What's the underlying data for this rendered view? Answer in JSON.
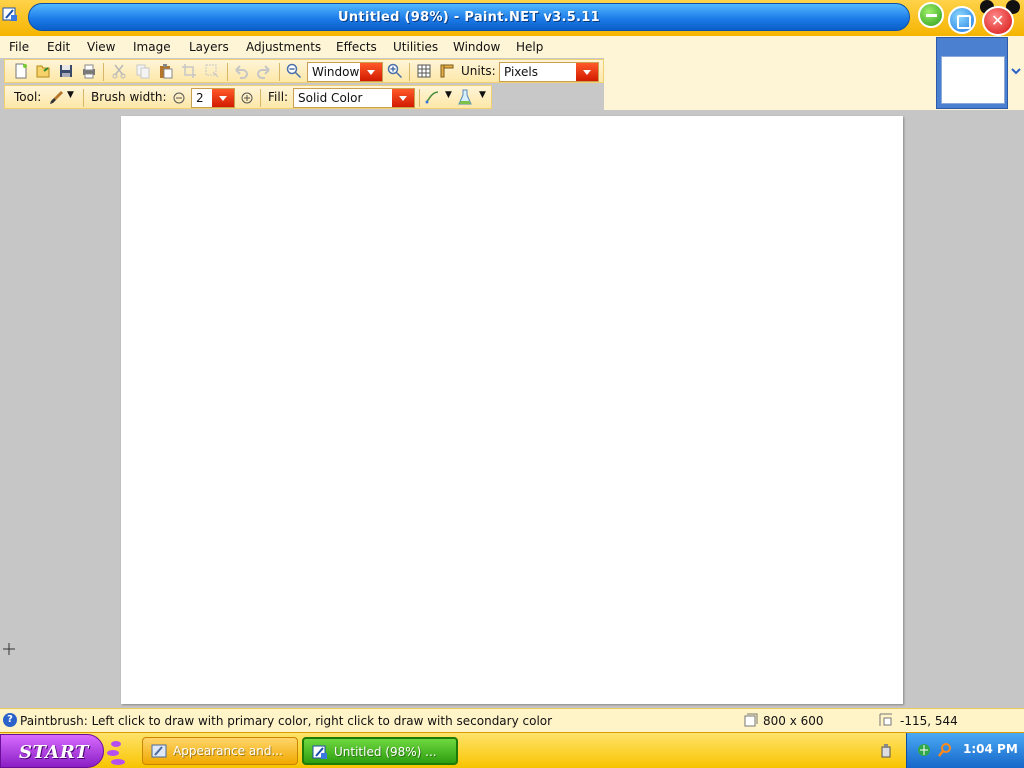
{
  "window": {
    "title": "Untitled (98%) - Paint.NET v3.5.11"
  },
  "menu": [
    "File",
    "Edit",
    "View",
    "Image",
    "Layers",
    "Adjustments",
    "Effects",
    "Utilities",
    "Window",
    "Help"
  ],
  "toolbar": {
    "zoom_value": "Window",
    "units_label": "Units:",
    "units_value": "Pixels",
    "tool_label": "Tool:",
    "brush_width_label": "Brush width:",
    "brush_width_value": "2",
    "fill_label": "Fill:",
    "fill_value": "Solid Color"
  },
  "status": {
    "message": "Paintbrush: Left click to draw with primary color, right click to draw with secondary color",
    "image_size": "800 x 600",
    "cursor_position": "-115, 544"
  },
  "taskbar": {
    "start_label": "START",
    "tasks": [
      {
        "label": "Appearance and...",
        "active": false
      },
      {
        "label": "Untitled (98%) ...",
        "active": true
      }
    ],
    "clock": "1:04 PM"
  },
  "colors": {
    "title_bar": "#1a78e6",
    "theme_yellow": "#f8c400",
    "start_button": "#8a1ec4",
    "active_task": "#2e9e10"
  }
}
